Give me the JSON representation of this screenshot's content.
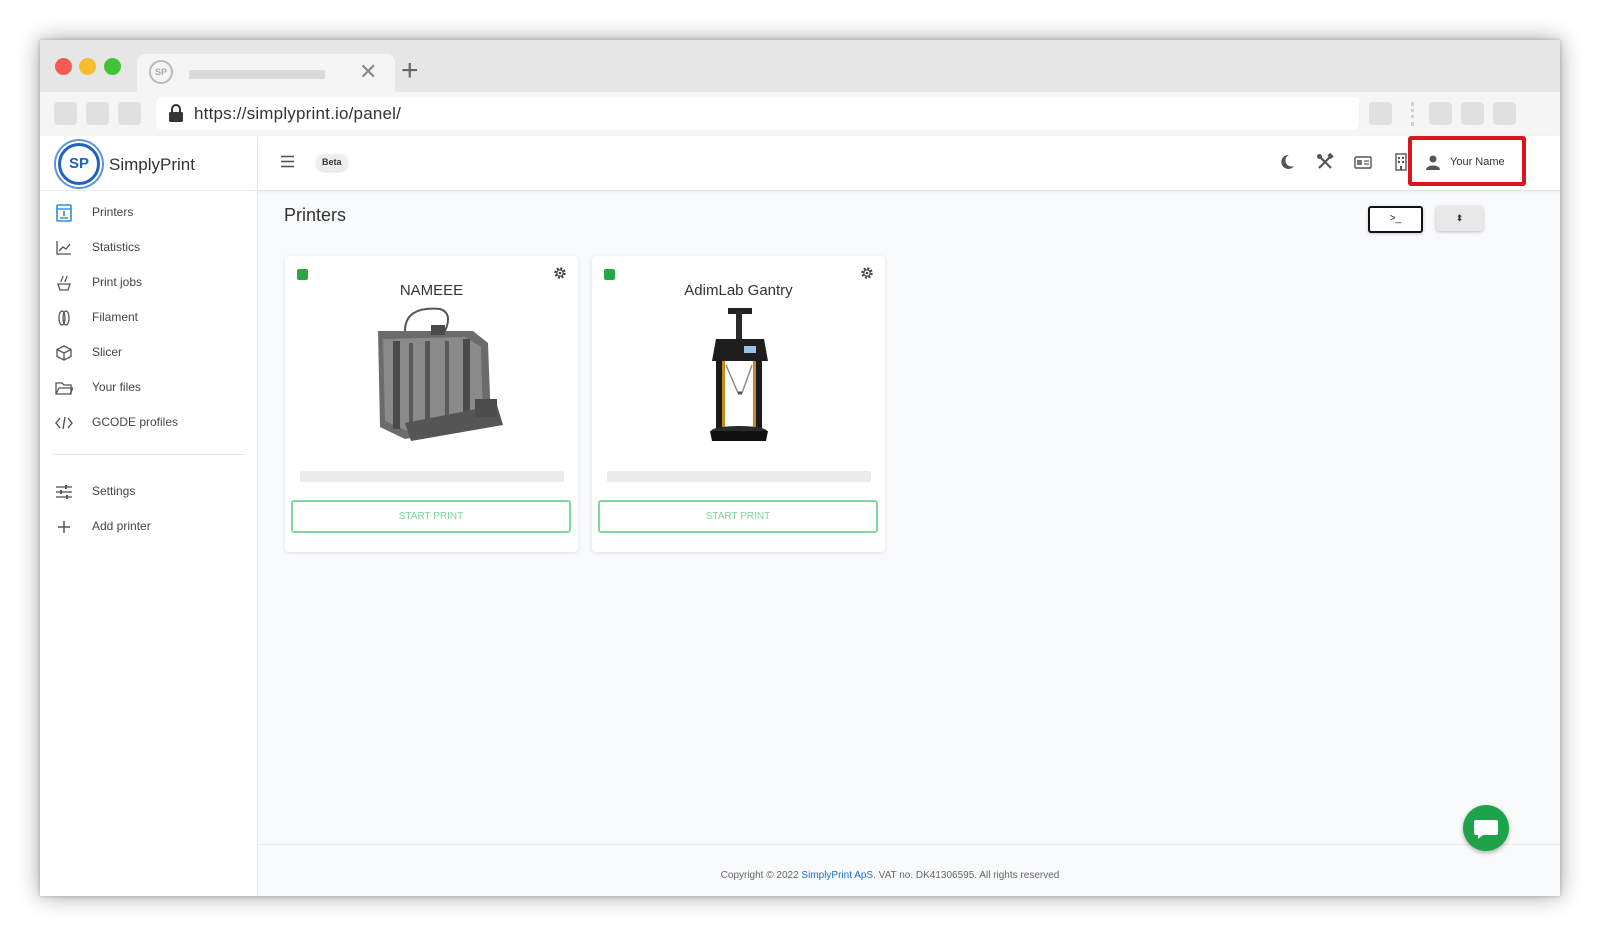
{
  "browser": {
    "tab": {
      "favicon_text": "SP",
      "close_glyph": "✕"
    },
    "new_tab_glyph": "+",
    "address": {
      "url": "https://simplyprint.io/panel/"
    }
  },
  "sidebar": {
    "brand": {
      "logo_text": "SP",
      "name": "SimplyPrint"
    },
    "items": [
      {
        "label": "Printers",
        "icon": "printer-icon"
      },
      {
        "label": "Statistics",
        "icon": "chart-icon"
      },
      {
        "label": "Print jobs",
        "icon": "print-jobs-icon"
      },
      {
        "label": "Filament",
        "icon": "filament-icon"
      },
      {
        "label": "Slicer",
        "icon": "cube-icon"
      },
      {
        "label": "Your files",
        "icon": "folder-icon"
      },
      {
        "label": "GCODE profiles",
        "icon": "code-icon"
      }
    ],
    "bottom_items": [
      {
        "label": "Settings",
        "icon": "sliders-icon"
      },
      {
        "label": "Add printer",
        "icon": "plus-icon"
      }
    ]
  },
  "topbar": {
    "beta_label": "Beta",
    "user": {
      "name": "Your Name"
    }
  },
  "main": {
    "title": "Printers",
    "terminal_button": ">_",
    "sort_button": "⬍",
    "printers": [
      {
        "name": "NAMEEE",
        "status_color": "#28a745",
        "action": "START PRINT"
      },
      {
        "name": "AdimLab Gantry",
        "status_color": "#28a745",
        "action": "START PRINT"
      }
    ]
  },
  "footer": {
    "copyright_prefix": "Copyright © 2022",
    "company": "SimplyPrint ApS",
    "suffix": "VAT no. DK41306595. All rights reserved"
  },
  "colors": {
    "accent_green": "#28a745",
    "highlight_red": "#d9161e",
    "brand_blue": "#1d62c4"
  }
}
